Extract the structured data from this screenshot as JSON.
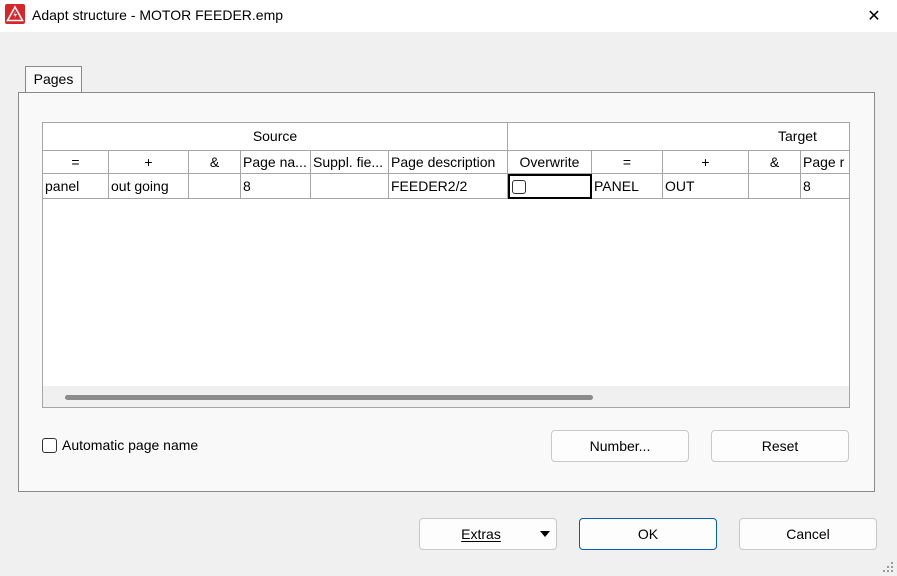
{
  "window": {
    "title": "Adapt structure - MOTOR FEEDER.emp",
    "close_glyph": "✕",
    "icon": "warning-triangle-icon",
    "accent": "#d9252a"
  },
  "tabs": [
    {
      "label": "Pages"
    }
  ],
  "grid": {
    "groups": {
      "source": "Source",
      "target": "Target"
    },
    "columns": [
      "=",
      "+",
      "&",
      "Page na...",
      "Suppl. fie...",
      "Page description",
      "Overwrite",
      "=",
      "+",
      "&",
      "Page r"
    ],
    "rows": [
      {
        "src_eq": "panel",
        "src_plus": "out going",
        "src_amp": "",
        "src_page": "8",
        "src_suppl": "",
        "src_desc": "FEEDER2/2",
        "overwrite": false,
        "tgt_eq": "PANEL",
        "tgt_plus": "OUT",
        "tgt_amp": "",
        "tgt_page": "8"
      }
    ]
  },
  "options": {
    "automatic_page_name_label": "Automatic page name",
    "automatic_page_name_checked": false
  },
  "buttons": {
    "number": "Number...",
    "reset": "Reset",
    "extras": "Extras",
    "ok": "OK",
    "cancel": "Cancel"
  }
}
